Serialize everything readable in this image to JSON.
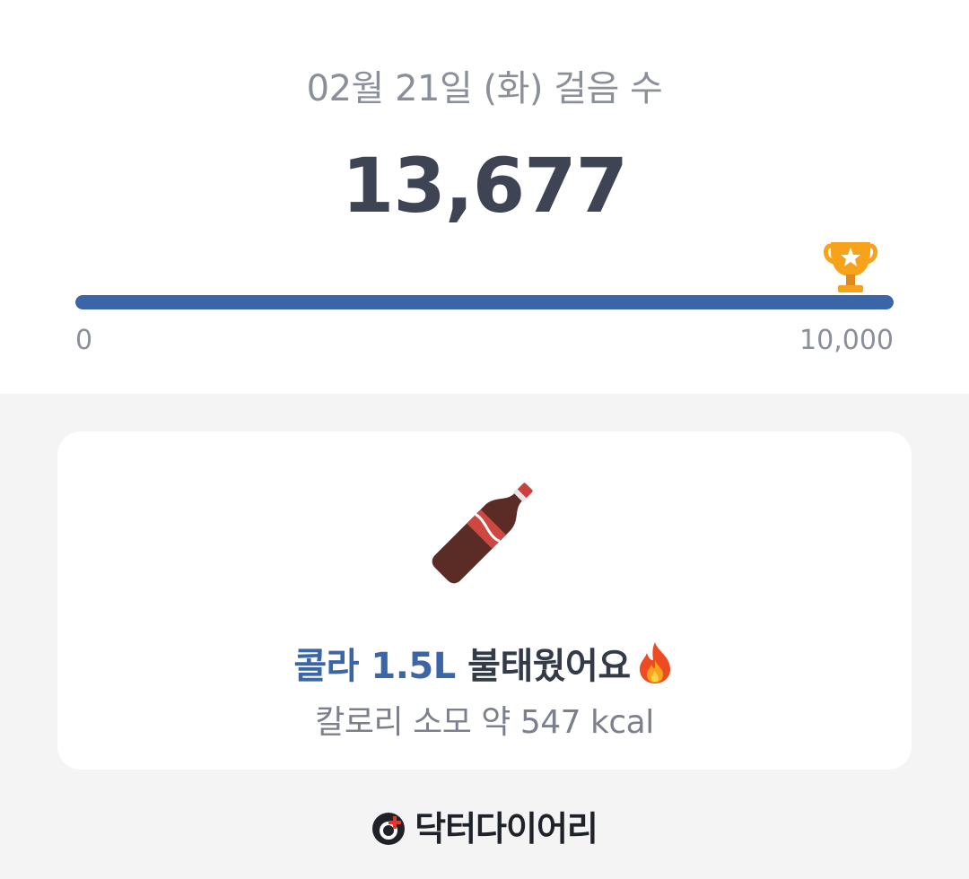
{
  "header": {
    "title": "02월 21일 (화) 걸음 수",
    "steps": "13,677"
  },
  "progress": {
    "min_label": "0",
    "max_label": "10,000",
    "fill_percent": 100,
    "goal_icon": "trophy-icon"
  },
  "card": {
    "item_icon": "cola-bottle-icon",
    "headline_item": "콜라 1.5L",
    "headline_rest": " 불태웠어요",
    "headline_icon": "fire-icon",
    "subtitle": "칼로리 소모 약 547 kcal"
  },
  "footer": {
    "brand_name": "닥터다이어리",
    "logo_icon": "doctor-diary-logo-icon"
  },
  "colors": {
    "accent": "#3a66a8",
    "text_dark": "#3e4454",
    "text_muted": "#8a8f9a",
    "background": "#f4f4f4"
  }
}
